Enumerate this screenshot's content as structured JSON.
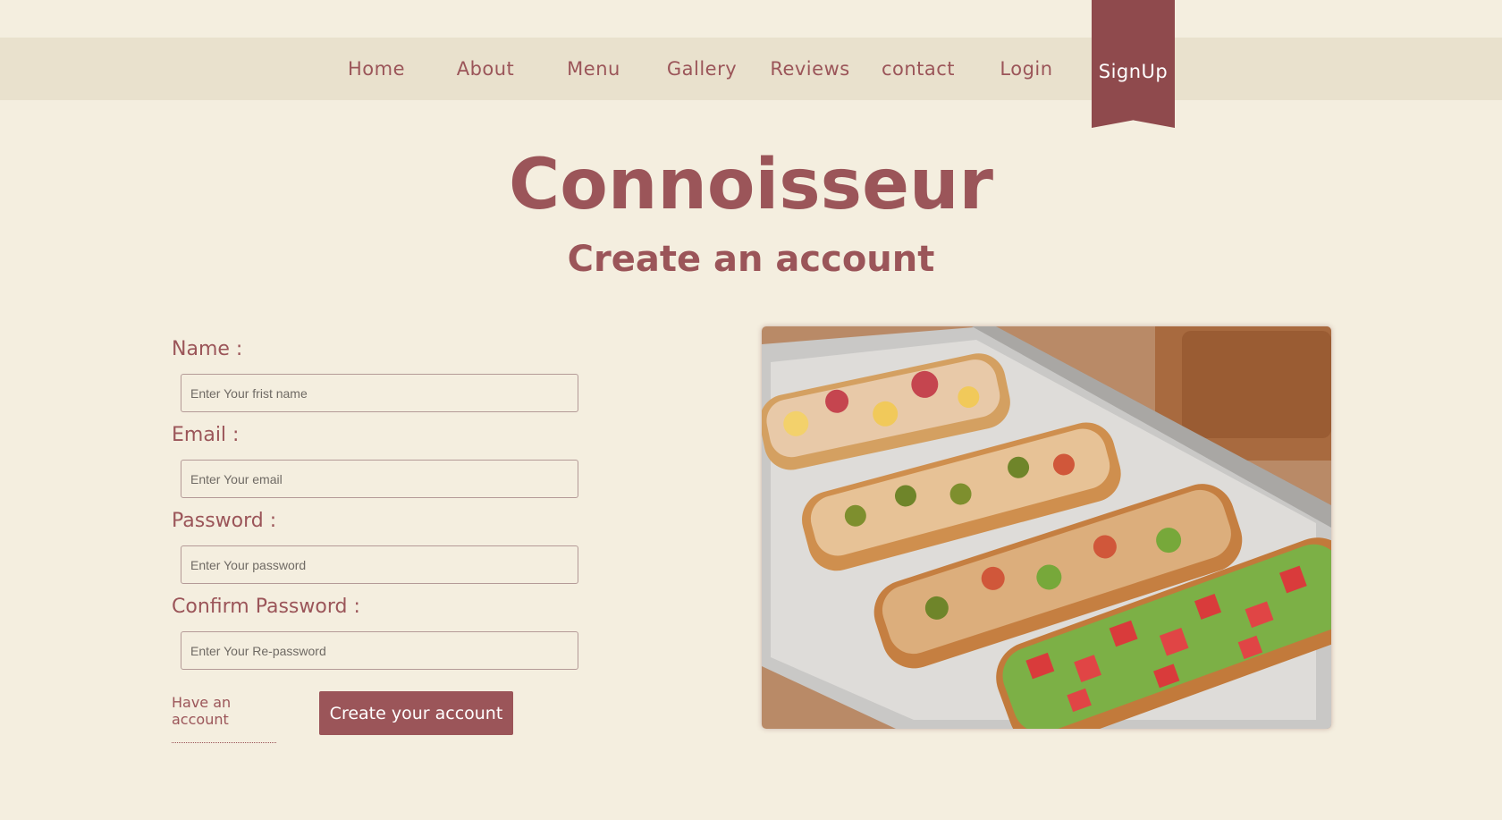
{
  "nav": {
    "items": [
      "Home",
      "About",
      "Menu",
      "Gallery",
      "Reviews",
      "contact",
      "Login"
    ],
    "active": "SignUp"
  },
  "header": {
    "brand": "Connoisseur",
    "subtitle": "Create an account"
  },
  "form": {
    "name_label": "Name :",
    "name_placeholder": "Enter Your frist name",
    "email_label": "Email :",
    "email_placeholder": "Enter Your email",
    "password_label": "Password :",
    "password_placeholder": "Enter Your password",
    "confirm_label": "Confirm Password :",
    "confirm_placeholder": "Enter Your Re-password",
    "have_account": "Have an account",
    "submit_label": "Create your account"
  },
  "colors": {
    "background": "#f4eedf",
    "navbar": "#e9e1cd",
    "accent": "#9b5559",
    "ribbon": "#8f4a4d"
  },
  "image": {
    "subject": "food-photo"
  }
}
